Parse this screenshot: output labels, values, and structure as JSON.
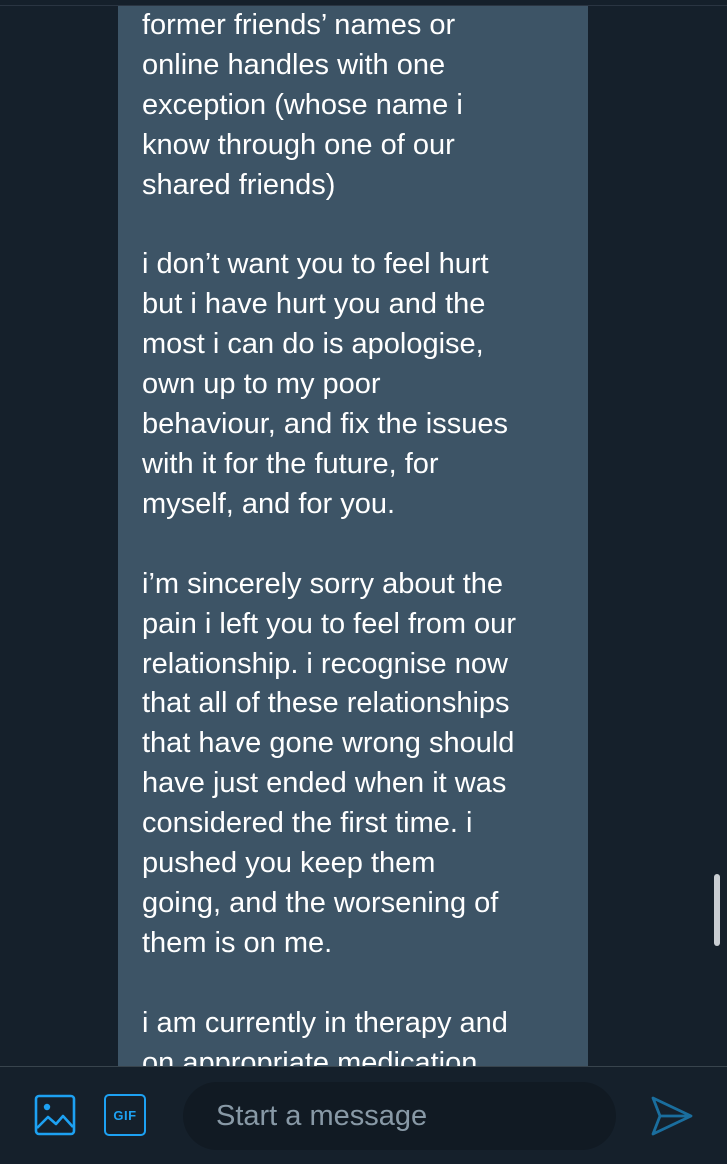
{
  "conversation": {
    "message_text": "former friends’ names or\nonline handles with one\nexception (whose name i\nknow through one of our\nshared friends)\n\ni don’t want you to feel hurt\nbut i have hurt you and the\nmost i can do is apologise,\nown up to my poor\nbehaviour, and fix the issues\nwith it for the future, for\nmyself, and for you.\n\ni’m sincerely sorry about the\npain i left you to feel from our\nrelationship. i recognise now\nthat all of these relationships\nthat have gone wrong should\nhave just ended when it was\nconsidered the first time. i\npushed you keep them\ngoing, and the worsening of\nthem is on me.\n\ni am currently in therapy and\non appropriate medication"
  },
  "composer": {
    "media_icon": "image-icon",
    "gif_label": "GIF",
    "input_placeholder": "Start a message",
    "input_value": "",
    "send_icon": "send-icon"
  },
  "colors": {
    "background": "#15202b",
    "bubble": "#3d5466",
    "accent": "#1da1f2",
    "placeholder": "#8899a6"
  }
}
